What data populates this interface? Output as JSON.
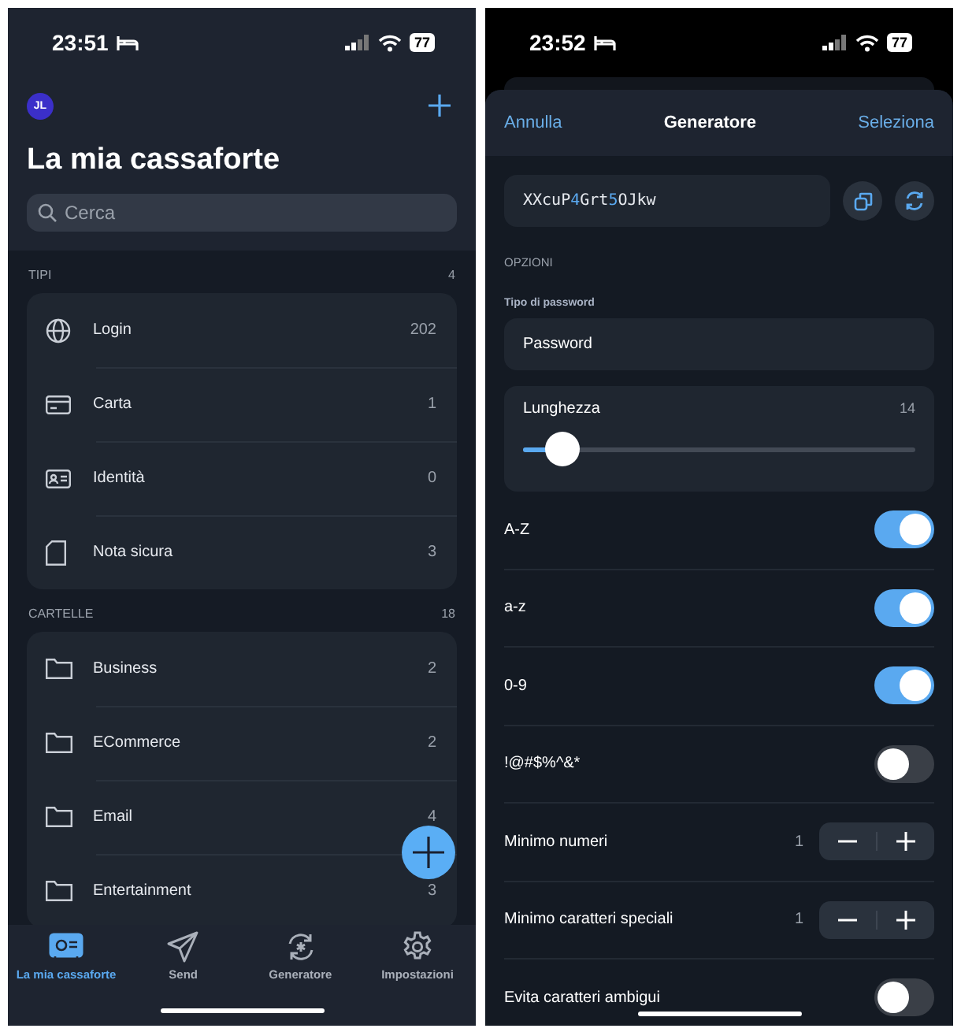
{
  "vault_screen": {
    "status_bar": {
      "time": "23:51",
      "battery": "77"
    },
    "avatar": "JL",
    "title": "La mia cassaforte",
    "search": {
      "placeholder": "Cerca"
    },
    "sections": [
      {
        "title": "TIPI",
        "count": "4",
        "items": [
          {
            "label": "Login",
            "count": "202",
            "kind": "globe"
          },
          {
            "label": "Carta",
            "count": "1",
            "kind": "card"
          },
          {
            "label": "Identità",
            "count": "0",
            "kind": "identity"
          },
          {
            "label": "Nota sicura",
            "count": "3",
            "kind": "note"
          }
        ]
      },
      {
        "title": "CARTELLE",
        "count": "18",
        "items": [
          {
            "label": "Business",
            "count": "2",
            "kind": "folder"
          },
          {
            "label": "ECommerce",
            "count": "2",
            "kind": "folder"
          },
          {
            "label": "Email",
            "count": "4",
            "kind": "folder"
          },
          {
            "label": "Entertainment",
            "count": "3",
            "kind": "folder"
          }
        ]
      }
    ],
    "tabs": [
      {
        "label": "La mia cassaforte",
        "kind": "vault",
        "selected": true
      },
      {
        "label": "Send",
        "kind": "send",
        "selected": false
      },
      {
        "label": "Generatore",
        "kind": "generator",
        "selected": false
      },
      {
        "label": "Impostazioni",
        "kind": "settings",
        "selected": false
      }
    ]
  },
  "generator_screen": {
    "status_bar": {
      "time": "23:52",
      "battery": "77"
    },
    "cancel": "Annulla",
    "title": "Generatore",
    "select": "Seleziona",
    "password": [
      {
        "text": "XXcuP",
        "kind": "letters"
      },
      {
        "text": "4",
        "kind": "digit"
      },
      {
        "text": "Grt",
        "kind": "letters"
      },
      {
        "text": "5",
        "kind": "digit"
      },
      {
        "text": "OJkw",
        "kind": "letters"
      }
    ],
    "options_title": "OPZIONI",
    "type_label": "Tipo di password",
    "type_value": "Password",
    "length": {
      "label": "Lunghezza",
      "value": "14",
      "level": 0.1
    },
    "options": [
      {
        "kind": "toggle",
        "label": "A-Z",
        "on": true
      },
      {
        "kind": "toggle",
        "label": "a-z",
        "on": true
      },
      {
        "kind": "toggle",
        "label": "0-9",
        "on": true
      },
      {
        "kind": "toggle",
        "label": "!@#$%^&*",
        "on": false
      },
      {
        "kind": "stepper",
        "label": "Minimo numeri",
        "value": "1"
      },
      {
        "kind": "stepper",
        "label": "Minimo caratteri speciali",
        "value": "1"
      },
      {
        "kind": "toggle",
        "label": "Evita caratteri ambigui",
        "on": false
      }
    ]
  }
}
